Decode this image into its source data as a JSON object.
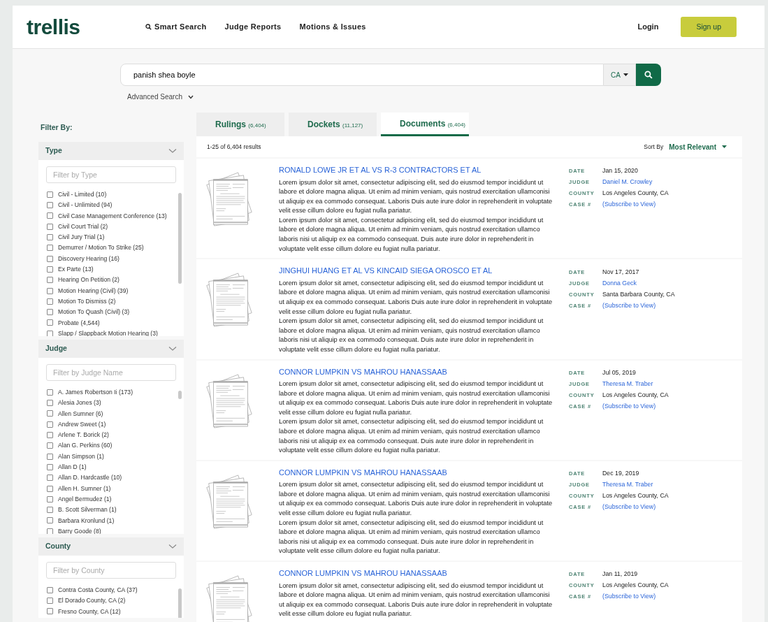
{
  "header": {
    "logo": "trellis",
    "nav": [
      {
        "label": "Smart Search",
        "icon": true
      },
      {
        "label": "Judge Reports",
        "icon": false
      },
      {
        "label": "Motions & Issues",
        "icon": false
      }
    ],
    "login": "Login",
    "signup": "Sign up"
  },
  "search": {
    "value": "panish shea boyle",
    "state": "CA",
    "advanced": "Advanced Search"
  },
  "filter_title": "Filter By:",
  "filters": [
    {
      "title": "Type",
      "placeholder": "Filter by Type",
      "items": [
        {
          "label": "Civil - Limited (10)",
          "checked": false
        },
        {
          "label": "Civil - Unlimited (94)",
          "checked": false
        },
        {
          "label": "Civil Case Management Conference (13)",
          "checked": false
        },
        {
          "label": "Civil Court Trial (2)",
          "checked": false
        },
        {
          "label": "Civil Jury Trial (1)",
          "checked": false
        },
        {
          "label": "Demurrer / Motion To Strike (25)",
          "checked": false
        },
        {
          "label": "Discovery Hearing (16)",
          "checked": false
        },
        {
          "label": "Ex Parte (13)",
          "checked": false
        },
        {
          "label": "Hearing On Petition (2)",
          "checked": false
        },
        {
          "label": "Motion Hearing (Civil) (39)",
          "checked": false
        },
        {
          "label": "Motion To Dismiss (2)",
          "checked": false
        },
        {
          "label": "Motion To Quash (Civil) (3)",
          "checked": false
        },
        {
          "label": "Probate (4,544)",
          "checked": false
        },
        {
          "label": "Slapp / Slappback Motion Hearing (3)",
          "checked": false
        }
      ]
    },
    {
      "title": "Judge",
      "placeholder": "Filter by Judge Name",
      "items": [
        {
          "label": "A. James Robertson Ii (173)",
          "checked": false
        },
        {
          "label": "Alesia Jones (3)",
          "checked": false
        },
        {
          "label": "Allen Sumner (6)",
          "checked": false
        },
        {
          "label": "Andrew Sweet (1)",
          "checked": false
        },
        {
          "label": "Arlene T. Borick (2)",
          "checked": false
        },
        {
          "label": "Alan G. Perkins (60)",
          "checked": false
        },
        {
          "label": "Alan Simpson (1)",
          "checked": false
        },
        {
          "label": "Allan D (1)",
          "checked": false
        },
        {
          "label": "Allan D. Hardcastle (10)",
          "checked": false
        },
        {
          "label": "Allen H. Sumner (1)",
          "checked": false
        },
        {
          "label": "Angel Bermudez (1)",
          "checked": false
        },
        {
          "label": "B. Scott Silverman (1)",
          "checked": false
        },
        {
          "label": "Barbara Kronlund (1)",
          "checked": false
        },
        {
          "label": "Barry Goode (8)",
          "checked": false
        }
      ]
    },
    {
      "title": "County",
      "placeholder": "Filter by County",
      "items": [
        {
          "label": "Contra Costa County, CA (37)",
          "checked": false
        },
        {
          "label": "El Dorado County, CA (2)",
          "checked": false
        },
        {
          "label": "Fresno County, CA (12)",
          "checked": false
        }
      ]
    }
  ],
  "tabs": [
    {
      "label": "Rulings",
      "count": "(6,404)",
      "selected": false
    },
    {
      "label": "Dockets",
      "count": "(11,127)",
      "selected": false
    },
    {
      "label": "Documents",
      "count": "(6,404)",
      "selected": true
    }
  ],
  "results_count": "1-25 of 6,404 results",
  "sort": {
    "label": "Sort By",
    "value": "Most Relevant"
  },
  "results": [
    {
      "title": "RONALD LOWE JR ET AL VS R-3 CONTRACTORS ET AL",
      "paragraphs": [
        "Lorem ipsum dolor sit amet, consectetur adipiscing elit, sed do eiusmod tempor incididunt ut labore et dolore magna aliqua. Ut enim ad minim veniam, quis nostrud exercitation ullamconisi ut aliquip ex ea commodo consequat. Laboris Duis aute irure dolor in reprehenderit in voluptate velit esse cillum dolore eu fugiat nulla pariatur.",
        "Lorem ipsum dolor sit amet, consectetur adipiscing elit, sed do eiusmod tempor incididunt ut labore et dolore magna aliqua. Ut enim ad minim veniam, quis nostrud exercitation ullamco laboris nisi ut aliquip ex ea commodo consequat. Duis aute irure dolor in reprehenderit in voluptate velit esse cillum dolore eu fugiat nulla pariatur."
      ],
      "meta": [
        {
          "label": "DATE",
          "value": "Jan 15, 2020",
          "kind": "text"
        },
        {
          "label": "JUDGE",
          "value": "Daniel M. Crowley",
          "kind": "link"
        },
        {
          "label": "COUNTY",
          "value": "Los Angeles County, CA",
          "kind": "text"
        },
        {
          "label": "CASE #",
          "value": "(Subscribe to View)",
          "kind": "link"
        }
      ]
    },
    {
      "title": "JINGHUI HUANG ET AL VS KINCAID SIEGA OROSCO ET AL",
      "paragraphs": [
        "Lorem ipsum dolor sit amet, consectetur adipiscing elit, sed do eiusmod tempor incididunt ut labore et dolore magna aliqua. Ut enim ad minim veniam, quis nostrud exercitation ullamconisi ut aliquip ex ea commodo consequat. Laboris Duis aute irure dolor in reprehenderit in voluptate velit esse cillum dolore eu fugiat nulla pariatur.",
        "Lorem ipsum dolor sit amet, consectetur adipiscing elit, sed do eiusmod tempor incididunt ut labore et dolore magna aliqua. Ut enim ad minim veniam, quis nostrud exercitation ullamco laboris nisi ut aliquip ex ea commodo consequat. Duis aute irure dolor in reprehenderit in voluptate velit esse cillum dolore eu fugiat nulla pariatur."
      ],
      "meta": [
        {
          "label": "DATE",
          "value": "Nov 17, 2017",
          "kind": "text"
        },
        {
          "label": "JUDGE",
          "value": "Donna Geck",
          "kind": "link"
        },
        {
          "label": "COUNTY",
          "value": "Santa Barbara County, CA",
          "kind": "text"
        },
        {
          "label": "CASE #",
          "value": "(Subscribe to View)",
          "kind": "link"
        }
      ]
    },
    {
      "title": "CONNOR LUMPKIN VS MAHROU HANASSAAB",
      "paragraphs": [
        "Lorem ipsum dolor sit amet, consectetur adipiscing elit, sed do eiusmod tempor incididunt ut labore et dolore magna aliqua. Ut enim ad minim veniam, quis nostrud exercitation ullamconisi ut aliquip ex ea commodo consequat. Laboris Duis aute irure dolor in reprehenderit in voluptate velit esse cillum dolore eu fugiat nulla pariatur.",
        "Lorem ipsum dolor sit amet, consectetur adipiscing elit, sed do eiusmod tempor incididunt ut labore et dolore magna aliqua. Ut enim ad minim veniam, quis nostrud exercitation ullamco laboris nisi ut aliquip ex ea commodo consequat. Duis aute irure dolor in reprehenderit in voluptate velit esse cillum dolore eu fugiat nulla pariatur."
      ],
      "meta": [
        {
          "label": "DATE",
          "value": "Jul 05, 2019",
          "kind": "text"
        },
        {
          "label": "JUDGE",
          "value": "Theresa M. Traber",
          "kind": "link"
        },
        {
          "label": "COUNTY",
          "value": "Los Angeles County, CA",
          "kind": "text"
        },
        {
          "label": "CASE #",
          "value": "(Subscribe to View)",
          "kind": "link"
        }
      ]
    },
    {
      "title": "CONNOR LUMPKIN VS MAHROU HANASSAAB",
      "paragraphs": [
        "Lorem ipsum dolor sit amet, consectetur adipiscing elit, sed do eiusmod tempor incididunt ut labore et dolore magna aliqua. Ut enim ad minim veniam, quis nostrud exercitation ullamconisi ut aliquip ex ea commodo consequat. Laboris Duis aute irure dolor in reprehenderit in voluptate velit esse cillum dolore eu fugiat nulla pariatur.",
        "Lorem ipsum dolor sit amet, consectetur adipiscing elit, sed do eiusmod tempor incididunt ut labore et dolore magna aliqua. Ut enim ad minim veniam, quis nostrud exercitation ullamco laboris nisi ut aliquip ex ea commodo consequat. Duis aute irure dolor in reprehenderit in voluptate velit esse cillum dolore eu fugiat nulla pariatur."
      ],
      "meta": [
        {
          "label": "DATE",
          "value": "Dec 19, 2019",
          "kind": "text"
        },
        {
          "label": "JUDGE",
          "value": "Theresa M. Traber",
          "kind": "link"
        },
        {
          "label": "COUNTY",
          "value": "Los Angeles County, CA",
          "kind": "text"
        },
        {
          "label": "CASE #",
          "value": "(Subscribe to View)",
          "kind": "link"
        }
      ]
    },
    {
      "title": "CONNOR LUMPKIN VS MAHROU HANASSAAB",
      "paragraphs": [
        "Lorem ipsum dolor sit amet, consectetur adipiscing elit, sed do eiusmod tempor incididunt ut labore et dolore magna aliqua. Ut enim ad minim veniam, quis nostrud exercitation ullamconisi ut aliquip ex ea commodo consequat. Laboris Duis aute irure dolor in reprehenderit in voluptate velit esse cillum dolore eu fugiat nulla pariatur."
      ],
      "meta": [
        {
          "label": "DATE",
          "value": "Jan 11, 2019",
          "kind": "text"
        },
        {
          "label": "COUNTY",
          "value": "Los Angeles County, CA",
          "kind": "text"
        },
        {
          "label": "CASE #",
          "value": "(Subscribe to View)",
          "kind": "link"
        }
      ]
    }
  ]
}
